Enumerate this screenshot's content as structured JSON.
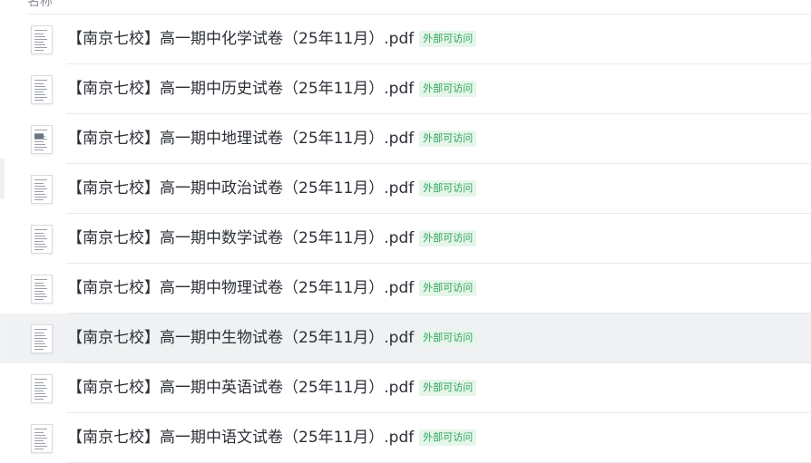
{
  "header": {
    "name_column_label": "名称"
  },
  "files": [
    {
      "name": "【南京七校】高一期中化学试卷（25年11月）.pdf",
      "badge": "外部可访问"
    },
    {
      "name": "【南京七校】高一期中历史试卷（25年11月）.pdf",
      "badge": "外部可访问"
    },
    {
      "name": "【南京七校】高一期中地理试卷（25年11月）.pdf",
      "badge": "外部可访问"
    },
    {
      "name": "【南京七校】高一期中政治试卷（25年11月）.pdf",
      "badge": "外部可访问"
    },
    {
      "name": "【南京七校】高一期中数学试卷（25年11月）.pdf",
      "badge": "外部可访问"
    },
    {
      "name": "【南京七校】高一期中物理试卷（25年11月）.pdf",
      "badge": "外部可访问"
    },
    {
      "name": "【南京七校】高一期中生物试卷（25年11月）.pdf",
      "badge": "外部可访问"
    },
    {
      "name": "【南京七校】高一期中英语试卷（25年11月）.pdf",
      "badge": "外部可访问"
    },
    {
      "name": "【南京七校】高一期中语文试卷（25年11月）.pdf",
      "badge": "外部可访问"
    }
  ],
  "hovered_row_index": 6,
  "icons": {
    "file_thumbnail": "pdf-thumbnail-icon"
  },
  "colors": {
    "badge_text": "#2fa45a",
    "badge_bg": "#e6f6ea",
    "hover_bg": "#eff1f2"
  }
}
